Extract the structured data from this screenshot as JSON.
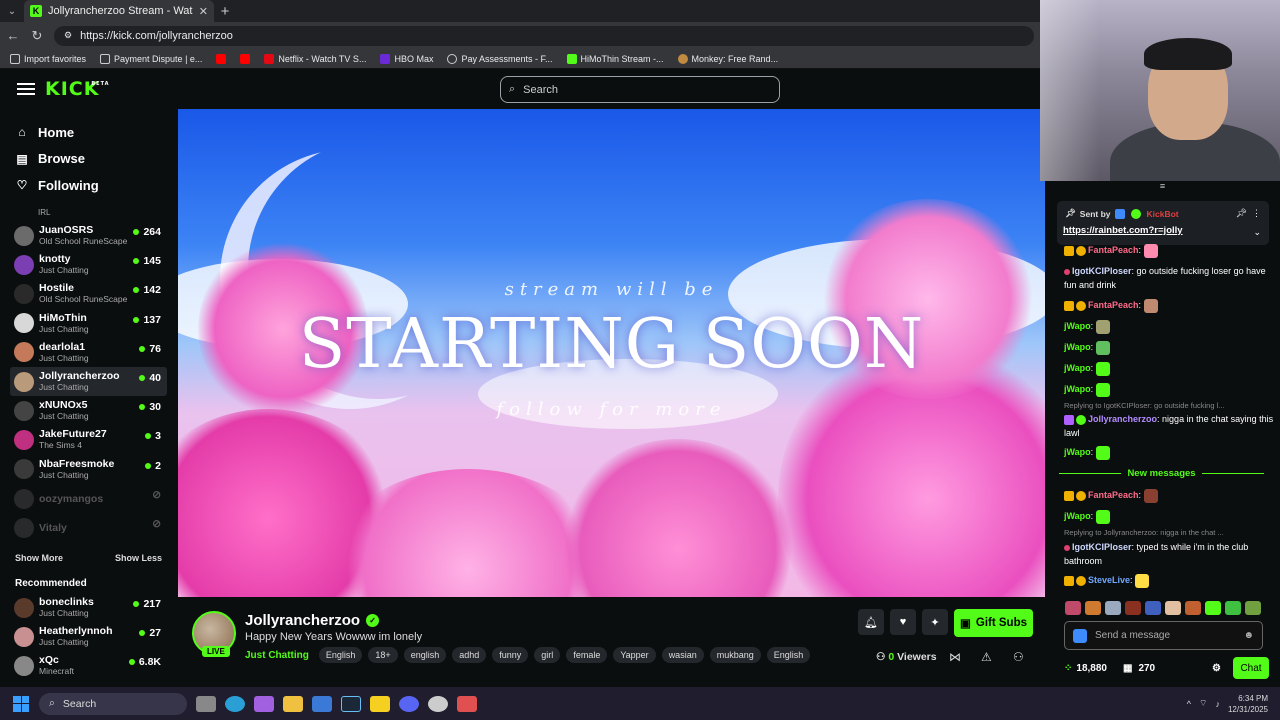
{
  "browser": {
    "tab_title": "Jollyrancherzoo Stream - Watch L",
    "url": "https://kick.com/jollyrancherzoo",
    "bookmarks": [
      "Import favorites",
      "Payment Dispute | e...",
      "Netflix - Watch TV S...",
      "HBO Max",
      "Pay Assessments - F...",
      "HiMoThin Stream -...",
      "Monkey: Free Rand..."
    ]
  },
  "header": {
    "logo": "KICK",
    "logo_sup": "BETA",
    "search_placeholder": "Search"
  },
  "sidebar": {
    "nav": [
      {
        "label": "Home",
        "icon": "home-icon"
      },
      {
        "label": "Browse",
        "icon": "browse-icon"
      },
      {
        "label": "Following",
        "icon": "heart-icon"
      }
    ],
    "partial_category": "IRL",
    "channels": [
      {
        "name": "JuanOSRS",
        "category": "Old School RuneScape",
        "viewers": "264",
        "color": "#6b6b6b"
      },
      {
        "name": "knotty",
        "category": "Just Chatting",
        "viewers": "145",
        "color": "#7b3fb3"
      },
      {
        "name": "Hostile",
        "category": "Old School RuneScape",
        "viewers": "142",
        "color": "#2a2a2a"
      },
      {
        "name": "HiMoThin",
        "category": "Just Chatting",
        "viewers": "137",
        "color": "#d8d8d8"
      },
      {
        "name": "dearlola1",
        "category": "Just Chatting",
        "viewers": "76",
        "color": "#c47a5a"
      },
      {
        "name": "Jollyrancherzoo",
        "category": "Just Chatting",
        "viewers": "40",
        "color": "#b99a7a"
      },
      {
        "name": "xNUNOx5",
        "category": "Just Chatting",
        "viewers": "30",
        "color": "#444"
      },
      {
        "name": "JakeFuture27",
        "category": "The Sims 4",
        "viewers": "3",
        "color": "#c03080"
      },
      {
        "name": "NbaFreesmoke",
        "category": "Just Chatting",
        "viewers": "2",
        "color": "#3a3a3a"
      }
    ],
    "offline_channels": [
      "oozymangos",
      "Vitaly"
    ],
    "show_more": "Show More",
    "show_less": "Show Less",
    "recommended_heading": "Recommended",
    "recommended": [
      {
        "name": "boneclinks",
        "category": "Just Chatting",
        "viewers": "217",
        "color": "#5a3a2a"
      },
      {
        "name": "Heatherlynnoh",
        "category": "Just Chatting",
        "viewers": "27",
        "color": "#c89090"
      },
      {
        "name": "xQc",
        "category": "Minecraft",
        "viewers": "6.8K",
        "color": "#888"
      }
    ]
  },
  "video": {
    "line1": "stream will be",
    "line2": "STARTING SOON",
    "line3": "follow for more"
  },
  "stream_info": {
    "channel": "Jollyrancherzoo",
    "live_label": "LIVE",
    "title": "Happy New Years Wowww im lonely",
    "category": "Just Chatting",
    "tags": [
      "English",
      "18+",
      "english",
      "adhd",
      "funny",
      "girl",
      "female",
      "Yapper",
      "wasian",
      "mukbang",
      "English"
    ],
    "gift_label": "Gift Subs",
    "viewers_count": "0",
    "viewers_label": "Viewers"
  },
  "chat": {
    "pinned_sent_by": "Sent by",
    "pinned_bot": "KickBot",
    "pinned_link": "https://rainbet.com?r=jolly",
    "messages": [
      {
        "user": "FantaPeach",
        "color": "#ff6b8a",
        "text": ""
      },
      {
        "user": "IgotKCIPloser",
        "color": "#cfd8ff",
        "text": "go outside fucking loser go have fun and drink"
      },
      {
        "user": "FantaPeach",
        "color": "#ff6b8a",
        "text": ""
      },
      {
        "user": "jWapo",
        "color": "#53fc18",
        "text": ""
      },
      {
        "user": "jWapo",
        "color": "#53fc18",
        "text": ""
      },
      {
        "user": "jWapo",
        "color": "#53fc18",
        "text": ""
      },
      {
        "user": "jWapo",
        "color": "#53fc18",
        "text": ""
      },
      {
        "reply": "Replying to IgotKCIPloser: go outside fucking l..."
      },
      {
        "user": "Jollyrancherzoo",
        "color": "#b48cff",
        "text": "nigga in the chat saying this lawl"
      },
      {
        "user": "jWapo",
        "color": "#53fc18",
        "text": ""
      },
      {
        "user": "FantaPeach",
        "color": "#ff6b8a",
        "text": ""
      },
      {
        "user": "jWapo",
        "color": "#53fc18",
        "text": ""
      },
      {
        "reply": "Replying to Jollyrancherzoo: nigga in the chat ..."
      },
      {
        "user": "IgotKCIPloser",
        "color": "#cfd8ff",
        "text": "typed ts while i'm in the club bathroom"
      },
      {
        "user": "SteveLive",
        "color": "#6fa8ff",
        "text": ""
      }
    ],
    "new_messages": "New messages",
    "input_placeholder": "Send a message",
    "points": "18,880",
    "gifts": "270",
    "chat_button": "Chat"
  },
  "taskbar": {
    "search": "Search",
    "time": "6:34 PM",
    "date": "12/31/2025"
  },
  "colors": {
    "accent": "#53fc18",
    "bg": "#0b0e0f"
  }
}
